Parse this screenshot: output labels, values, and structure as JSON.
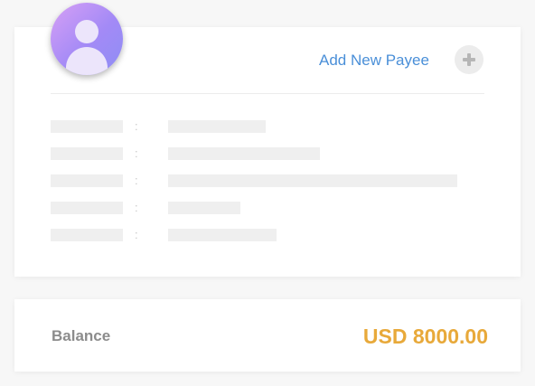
{
  "payee_card": {
    "add_payee_label": "Add New Payee",
    "add_icon": "plus-icon",
    "avatar_icon": "user-icon",
    "detail_rows": [
      {
        "separator": ":"
      },
      {
        "separator": ":"
      },
      {
        "separator": ":"
      },
      {
        "separator": ":"
      },
      {
        "separator": ":"
      }
    ]
  },
  "balance": {
    "label": "Balance",
    "amount": "USD 8000.00",
    "amount_color": "#e8a93a"
  },
  "colors": {
    "link": "#4a8fd8",
    "avatar_gradient": [
      "#d7a0f5",
      "#8e8ef4"
    ],
    "placeholder": "#efefef"
  }
}
